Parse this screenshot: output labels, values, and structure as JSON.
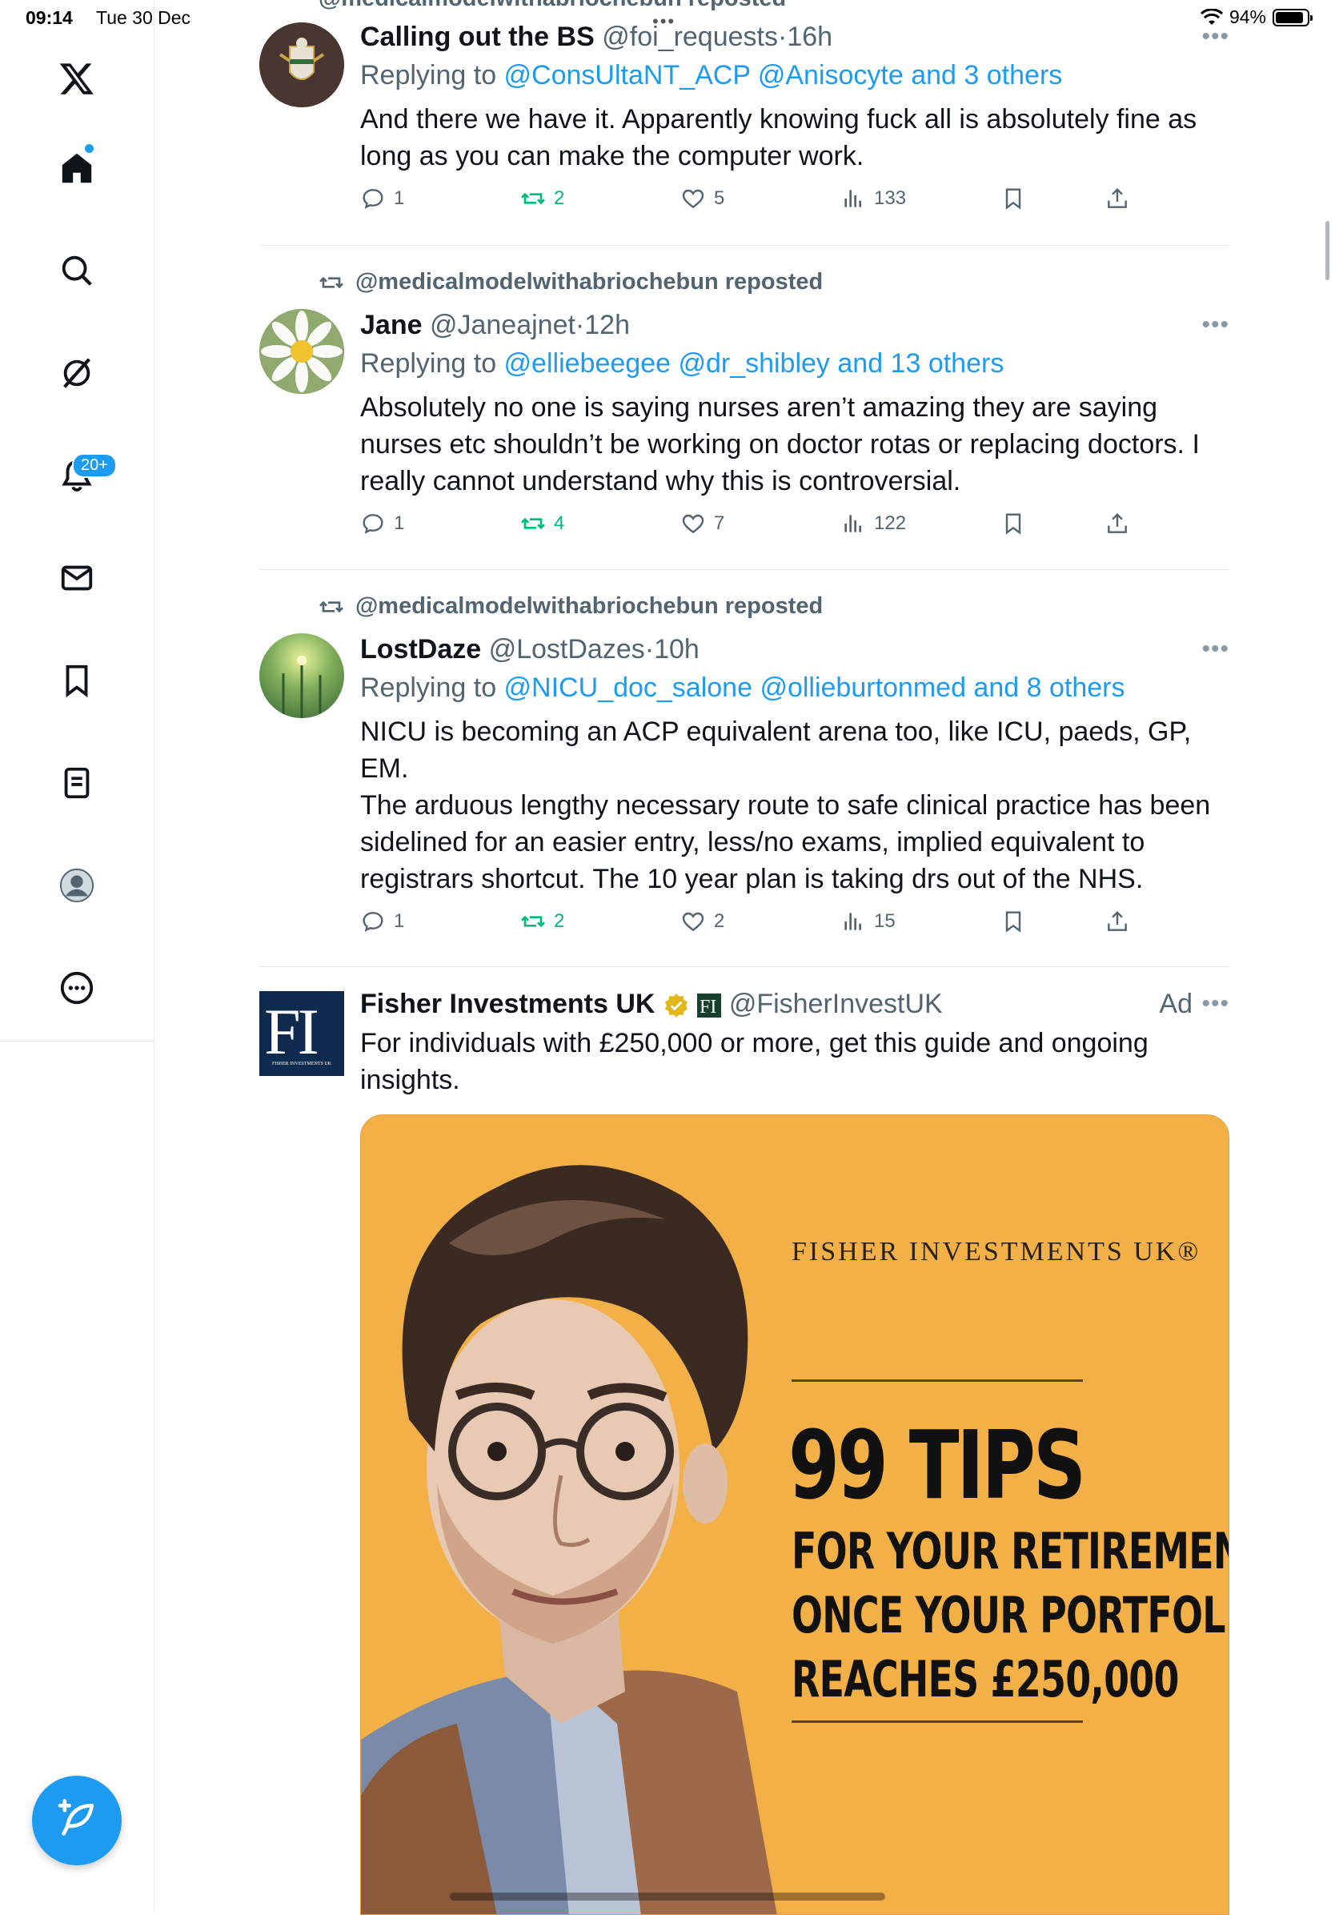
{
  "status_bar": {
    "time": "09:14",
    "date": "Tue 30 Dec",
    "battery": "94%"
  },
  "sidebar": {
    "notifications_badge": "20+",
    "items": [
      "x-logo",
      "home",
      "search",
      "grok",
      "notifications",
      "messages",
      "bookmarks",
      "lists",
      "profile",
      "more"
    ]
  },
  "top_partial": {
    "repost_text": "@medicalmodelwithabriochebun reposted"
  },
  "posts": [
    {
      "repost_by": "",
      "name": "Calling out the BS",
      "handle": "@foi_requests",
      "dot": "·",
      "ago": "16h",
      "replying_prefix": "Replying to ",
      "replying_links": "@ConsUltaNT_ACP @Anisocyte and 3 others",
      "text": "And there we have it. Apparently knowing fuck all is absolutely fine as long as you can make the computer work.",
      "replies": "1",
      "reposts": "2",
      "likes": "5",
      "views": "133"
    },
    {
      "repost_by": "@medicalmodelwithabriochebun reposted",
      "name": "Jane",
      "handle": "@Janeajnet",
      "dot": "·",
      "ago": "12h",
      "replying_prefix": "Replying to ",
      "replying_links": "@elliebeegee @dr_shibley and 13 others",
      "text": "Absolutely no one is saying nurses aren’t amazing they are saying nurses etc shouldn’t be working on doctor rotas or replacing doctors. I really cannot understand why this is controversial.",
      "replies": "1",
      "reposts": "4",
      "likes": "7",
      "views": "122"
    },
    {
      "repost_by": "@medicalmodelwithabriochebun reposted",
      "name": "LostDaze",
      "handle": "@LostDazes",
      "dot": "·",
      "ago": "10h",
      "replying_prefix": "Replying to ",
      "replying_links": "@NICU_doc_salone @ollieburtonmed and 8 others",
      "text_lines": [
        "NICU is becoming an ACP equivalent arena too, like ICU, paeds, GP, EM.",
        "The arduous lengthy necessary route to safe clinical practice has been sidelined for an easier entry, less/no exams, implied equivalent to registrars  shortcut. The 10 year plan is taking drs out of the NHS."
      ],
      "replies": "1",
      "reposts": "2",
      "likes": "2",
      "views": "15"
    }
  ],
  "ad": {
    "name": "Fisher Investments UK",
    "handle": "@FisherInvestUK",
    "ad_label": "Ad",
    "logo_text": "FI",
    "logo_caption": "FISHER INVESTMENTS UK",
    "text": "For individuals with £250,000 or more, get this guide and ongoing insights.",
    "image": {
      "brand": "FISHER INVESTMENTS UK®",
      "headline": "99 TIPS",
      "lines": [
        "FOR YOUR RETIREMENT",
        "ONCE YOUR PORTFOLIO",
        "REACHES £250,000"
      ]
    }
  },
  "colors": {
    "accent": "#1d9bf0",
    "repost_green": "#00ba7c",
    "ad_bg": "#f3b046",
    "text": "#0f1419",
    "muted": "#536471"
  }
}
